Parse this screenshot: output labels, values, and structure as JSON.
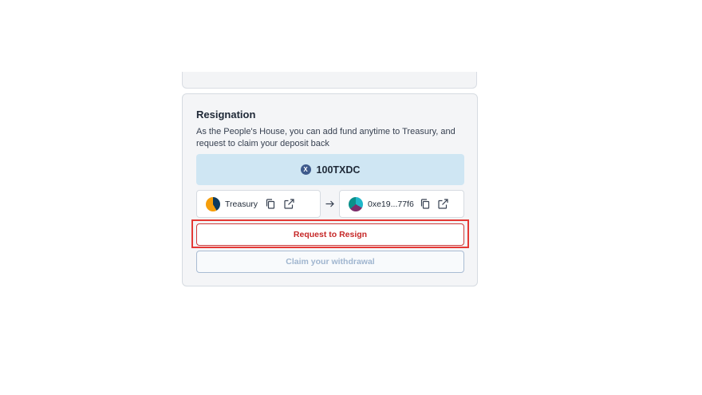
{
  "resignation": {
    "title": "Resignation",
    "description": "As the People's House, you can add fund anytime to Treasury, and request to claim your deposit back",
    "amount": "100TXDC",
    "token_icon": "txdc-token-icon",
    "from": {
      "label": "Treasury",
      "avatar": "treasury-avatar"
    },
    "to": {
      "label": "0xe19...77f6",
      "avatar": "wallet-avatar"
    },
    "buttons": {
      "resign_label": "Request to Resign",
      "claim_label": "Claim your withdrawal"
    }
  },
  "colors": {
    "amount_bg": "#cfe6f3",
    "resign_border": "#cf3a3a",
    "resign_text": "#c62828",
    "claim_text": "#9fb5cf",
    "highlight": "#e53935"
  }
}
